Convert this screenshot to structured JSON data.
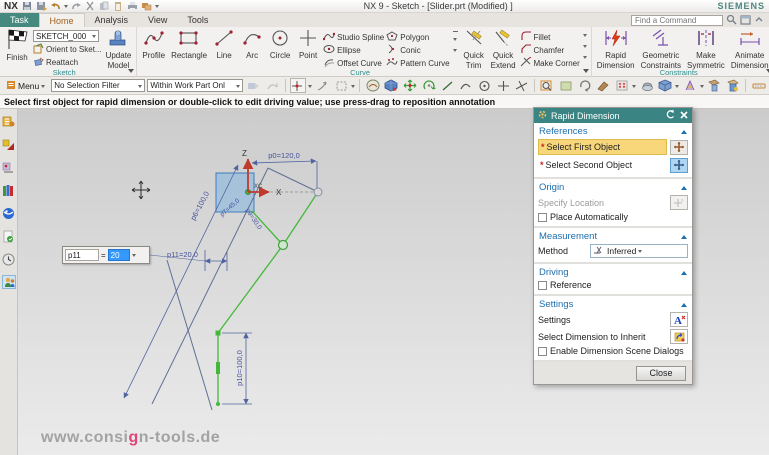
{
  "window": {
    "logo": "NX",
    "title": "NX 9 - Sketch - [Slider.prt (Modified) ]",
    "brand": "SIEMENS"
  },
  "tabs": {
    "task": "Task",
    "home": "Home",
    "analysis": "Analysis",
    "view": "View",
    "tools": "Tools",
    "find_placeholder": "Find a Command"
  },
  "ribbon": {
    "sketch": {
      "group": "Sketch",
      "finish": "Finish",
      "sketch_name": "SKETCH_000",
      "orient": "Orient to Sket...",
      "reattach": "Reattach",
      "update_line1": "Update",
      "update_line2": "Model"
    },
    "curve": {
      "group": "Curve",
      "profile": "Profile",
      "rectangle": "Rectangle",
      "line": "Line",
      "arc": "Arc",
      "circle": "Circle",
      "point": "Point",
      "studio_spline": "Studio Spline",
      "ellipse": "Ellipse",
      "offset_curve": "Offset Curve",
      "polygon": "Polygon",
      "conic": "Conic",
      "pattern_curve": "Pattern Curve",
      "quick_trim_1": "Quick",
      "quick_trim_2": "Trim",
      "quick_extend_1": "Quick",
      "quick_extend_2": "Extend",
      "fillet": "Fillet",
      "chamfer": "Chamfer",
      "make_corner": "Make Corner"
    },
    "constraints": {
      "group": "Constraints",
      "rapid_1": "Rapid",
      "rapid_2": "Dimension",
      "geometric_1": "Geometric",
      "geometric_2": "Constraints",
      "symmetric_1": "Make",
      "symmetric_2": "Symmetric",
      "animate_1": "Animate",
      "animate_2": "Dimension"
    }
  },
  "selection_bar": {
    "menu": "Menu",
    "filter": "No Selection Filter",
    "scope": "Within Work Part Onl"
  },
  "prompt": "Select first object for rapid dimension or double-click to edit driving value; use press-drag to reposition annotation",
  "canvas": {
    "axes": {
      "z": "Z",
      "x": "X",
      "xc": "XC"
    },
    "dims": {
      "p0": "p0=120,0",
      "p6": "p6=100,0",
      "p7": "p7=45,0",
      "p9": "p9=30,0",
      "p10": "p10=100,0",
      "p11": "p11=20,0"
    },
    "input": {
      "name": "p11",
      "eq": "=",
      "value": "20"
    },
    "watermark": {
      "pre": "www.consi",
      "accent": "g",
      "post": "n-tools.de"
    }
  },
  "dialog": {
    "title": "Rapid Dimension",
    "references": {
      "header": "References",
      "first": "Select First Object",
      "second": "Select Second Object",
      "required_mark": "*"
    },
    "origin": {
      "header": "Origin",
      "specify": "Specify Location",
      "auto": "Place Automatically"
    },
    "measurement": {
      "header": "Measurement",
      "method": "Method",
      "value": "Inferred"
    },
    "driving": {
      "header": "Driving",
      "reference": "Reference"
    },
    "settings": {
      "header": "Settings",
      "settings": "Settings",
      "inherit": "Select Dimension to Inherit",
      "enable": "Enable Dimension Scene Dialogs"
    },
    "close": "Close"
  },
  "colors": {
    "accent_teal": "#3a8583",
    "header_blue": "#1d6fae",
    "highlight_yellow": "#f7d779",
    "selection_blue": "#3399ff",
    "sketch_green": "#44b83c",
    "dimension_blue": "#5064a0",
    "axis_red": "#c03a2b"
  }
}
